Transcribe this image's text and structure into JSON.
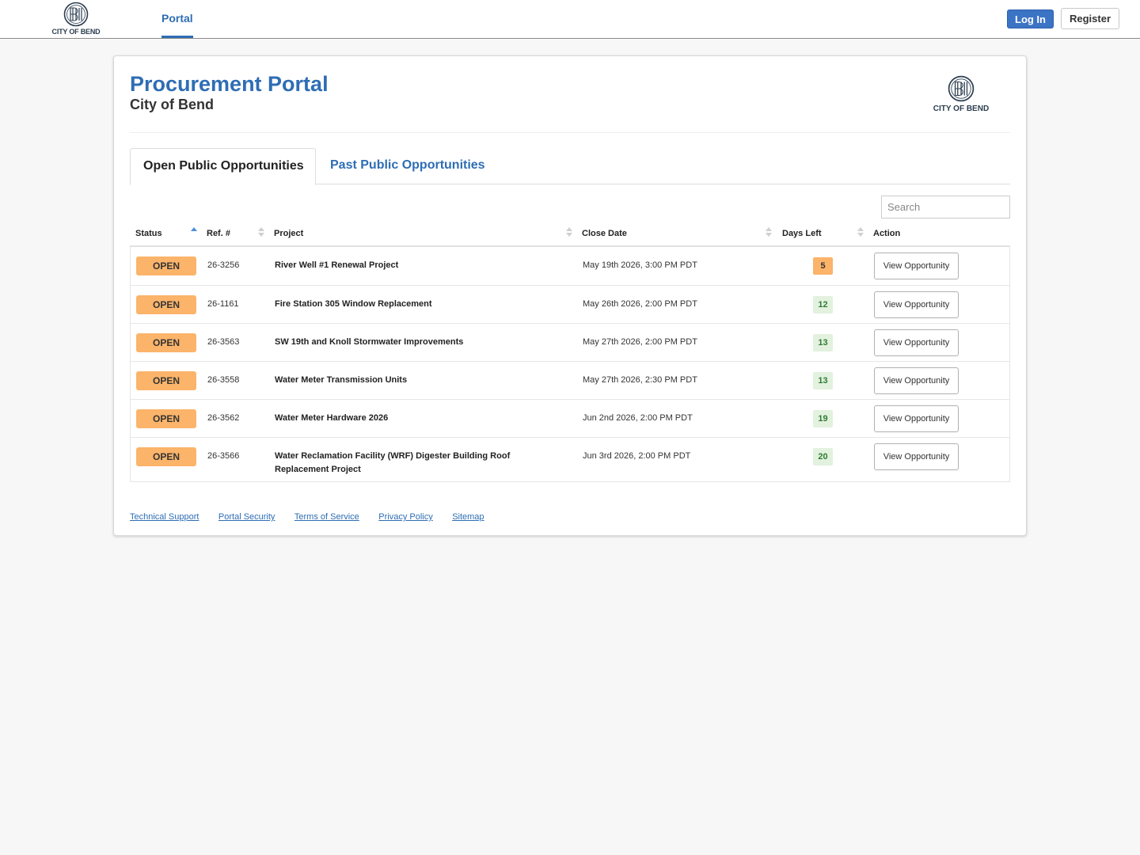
{
  "nav": {
    "logo_text": "CITY OF BEND",
    "tab_label": "Portal",
    "login_label": "Log In",
    "register_label": "Register"
  },
  "header": {
    "title": "Procurement Portal",
    "subtitle": "City of Bend",
    "logo_text": "CITY OF BEND"
  },
  "tabs": {
    "open": "Open Public Opportunities",
    "past": "Past Public Opportunities"
  },
  "search": {
    "placeholder": "Search"
  },
  "table": {
    "columns": {
      "status": "Status",
      "ref": "Ref. #",
      "project": "Project",
      "close_date": "Close Date",
      "days_left": "Days Left",
      "action": "Action"
    },
    "rows": [
      {
        "status": "OPEN",
        "ref": "26-3256",
        "project": "River Well #1 Renewal Project",
        "close_date": "May 19th 2026, 3:00 PM PDT",
        "days_left": "5",
        "action": "View Opportunity"
      },
      {
        "status": "OPEN",
        "ref": "26-1161",
        "project": "Fire Station 305 Window Replacement",
        "close_date": "May 26th 2026, 2:00 PM PDT",
        "days_left": "12",
        "action": "View Opportunity"
      },
      {
        "status": "OPEN",
        "ref": "26-3563",
        "project": "SW 19th and Knoll Stormwater Improvements",
        "close_date": "May 27th 2026, 2:00 PM PDT",
        "days_left": "13",
        "action": "View Opportunity"
      },
      {
        "status": "OPEN",
        "ref": "26-3558",
        "project": "Water Meter Transmission Units",
        "close_date": "May 27th 2026, 2:30 PM PDT",
        "days_left": "13",
        "action": "View Opportunity"
      },
      {
        "status": "OPEN",
        "ref": "26-3562",
        "project": "Water Meter Hardware 2026",
        "close_date": "Jun 2nd 2026, 2:00 PM PDT",
        "days_left": "19",
        "action": "View Opportunity"
      },
      {
        "status": "OPEN",
        "ref": "26-3566",
        "project": "Water Reclamation Facility (WRF) Digester Building Roof Replacement Project",
        "close_date": "Jun 3rd 2026, 2:00 PM PDT",
        "days_left": "20",
        "action": "View Opportunity"
      }
    ]
  },
  "footer": {
    "links": [
      "Technical Support",
      "Portal Security",
      "Terms of Service",
      "Privacy Policy",
      "Sitemap"
    ]
  },
  "colors": {
    "brand_blue": "#2e6db4",
    "open_badge": "#fbb46a",
    "days_ok_bg": "#e3f1df",
    "days_ok_text": "#2e7d32"
  }
}
